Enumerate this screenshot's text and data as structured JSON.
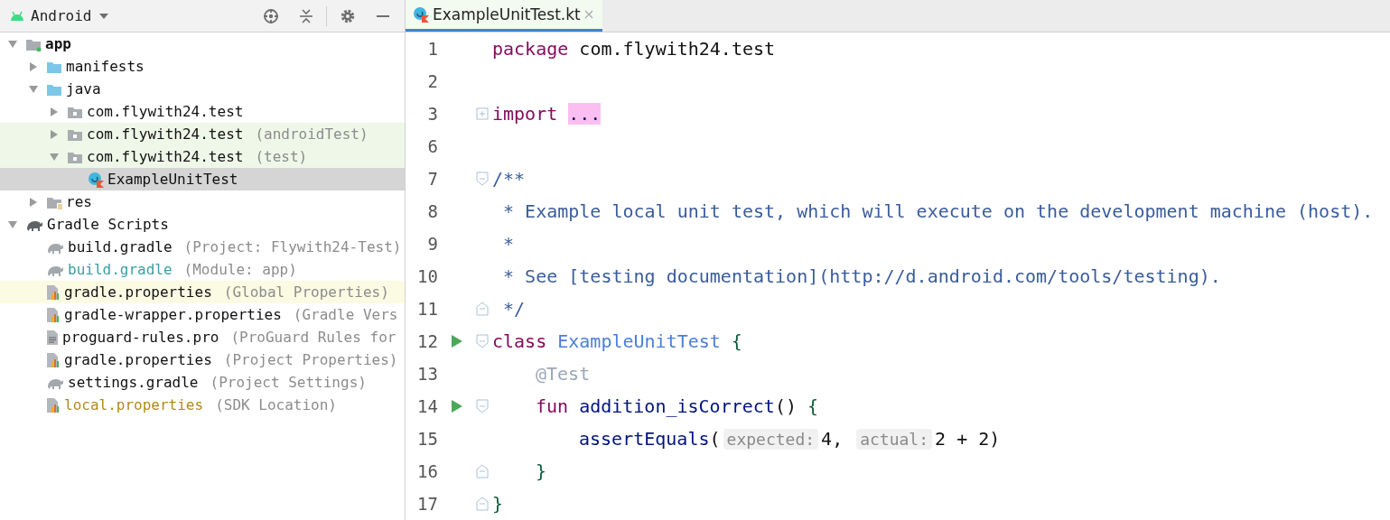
{
  "project_panel": {
    "view_selector": "Android",
    "tree": [
      {
        "label": "app",
        "kind": "module",
        "expanded": true,
        "selected": false,
        "bold": true,
        "children": [
          {
            "label": "manifests",
            "kind": "folder",
            "expanded": false,
            "selected": false
          },
          {
            "label": "java",
            "kind": "folder",
            "expanded": true,
            "selected": false,
            "children": [
              {
                "label": "com.flywith24.test",
                "kind": "package",
                "expanded": false,
                "selected": false
              },
              {
                "label": "com.flywith24.test",
                "detail": "(androidTest)",
                "kind": "package",
                "expanded": false,
                "selected": false,
                "test_source": true
              },
              {
                "label": "com.flywith24.test",
                "detail": "(test)",
                "kind": "package",
                "expanded": true,
                "selected": false,
                "test_source": true,
                "children": [
                  {
                    "label": "ExampleUnitTest",
                    "kind": "class",
                    "selected": true
                  }
                ]
              }
            ]
          },
          {
            "label": "res",
            "kind": "resources",
            "expanded": false,
            "selected": false
          }
        ]
      },
      {
        "label": "Gradle Scripts",
        "kind": "gradle-group",
        "expanded": true,
        "selected": false,
        "children": [
          {
            "label": "build.gradle",
            "detail": "(Project: Flywith24-Test)",
            "kind": "gradle",
            "selected": false
          },
          {
            "label": "build.gradle",
            "detail": "(Module: app)",
            "kind": "gradle",
            "selected": false,
            "modified": true
          },
          {
            "label": "gradle.properties",
            "detail": "(Global Properties)",
            "kind": "properties",
            "selected": false,
            "highlighted": true
          },
          {
            "label": "gradle-wrapper.properties",
            "detail": "(Gradle Vers",
            "kind": "properties",
            "selected": false
          },
          {
            "label": "proguard-rules.pro",
            "detail": "(ProGuard Rules for",
            "kind": "text",
            "selected": false
          },
          {
            "label": "gradle.properties",
            "detail": "(Project Properties)",
            "kind": "properties",
            "selected": false
          },
          {
            "label": "settings.gradle",
            "detail": "(Project Settings)",
            "kind": "gradle",
            "selected": false
          },
          {
            "label": "local.properties",
            "detail": "(SDK Location)",
            "kind": "properties",
            "selected": false,
            "ignored": true
          }
        ]
      }
    ]
  },
  "editor": {
    "tabs": [
      {
        "label": "ExampleUnitTest.kt",
        "selected": true
      }
    ],
    "lines": [
      {
        "number": "1",
        "tokens": [
          {
            "kind": "keyword",
            "text": "package"
          },
          {
            "kind": "plain",
            "text": " com.flywith24.test"
          }
        ]
      },
      {
        "number": "2"
      },
      {
        "number": "3",
        "folded": true,
        "tokens": [
          {
            "kind": "keyword",
            "text": "import"
          },
          {
            "kind": "folded",
            "text": "..."
          }
        ]
      },
      {
        "number": "6"
      },
      {
        "number": "7",
        "fold_start": true,
        "tokens": [
          {
            "kind": "doc",
            "text": "/**"
          }
        ]
      },
      {
        "number": "8",
        "tokens": [
          {
            "kind": "doc",
            "text": " * Example local unit test, which will execute on the development machine (host)."
          }
        ]
      },
      {
        "number": "9",
        "tokens": [
          {
            "kind": "doc",
            "text": " *"
          }
        ]
      },
      {
        "number": "10",
        "tokens": [
          {
            "kind": "doc",
            "text": " * See [testing documentation](http://d.android.com/tools/testing)."
          }
        ]
      },
      {
        "number": "11",
        "fold_end": true,
        "tokens": [
          {
            "kind": "doc",
            "text": " */"
          }
        ]
      },
      {
        "number": "12",
        "run": true,
        "fold_start": true,
        "tokens": [
          {
            "kind": "keyword",
            "text": "class"
          },
          {
            "kind": "class",
            "text": "ExampleUnitTest"
          },
          {
            "kind": "brace",
            "text": "{"
          }
        ],
        "children": [
          {
            "number": "13",
            "tokens": [
              {
                "kind": "annotation",
                "text": "@Test"
              }
            ]
          },
          {
            "number": "14",
            "run": true,
            "fold_start": true,
            "tokens": [
              {
                "kind": "keyword",
                "text": "fun"
              },
              {
                "kind": "function",
                "text": "addition_isCorrect"
              },
              {
                "kind": "plain",
                "text": "()"
              },
              {
                "kind": "brace",
                "text": "{"
              }
            ],
            "children": [
              {
                "number": "15",
                "tokens": [
                  {
                    "kind": "call",
                    "text": "assertEquals"
                  },
                  {
                    "kind": "plain",
                    "text": "("
                  },
                  {
                    "kind": "hint",
                    "text": "expected:"
                  },
                  {
                    "kind": "plain",
                    "text": "4,"
                  },
                  {
                    "kind": "hint",
                    "text": "actual:"
                  },
                  {
                    "kind": "plain",
                    "text": "2 + 2)"
                  }
                ]
              }
            ]
          },
          {
            "number": "16",
            "fold_end": true,
            "tokens": [
              {
                "kind": "brace",
                "text": "}"
              }
            ]
          }
        ]
      },
      {
        "number": "17",
        "fold_end": true,
        "tokens": [
          {
            "kind": "brace",
            "text": "}"
          }
        ]
      }
    ]
  }
}
